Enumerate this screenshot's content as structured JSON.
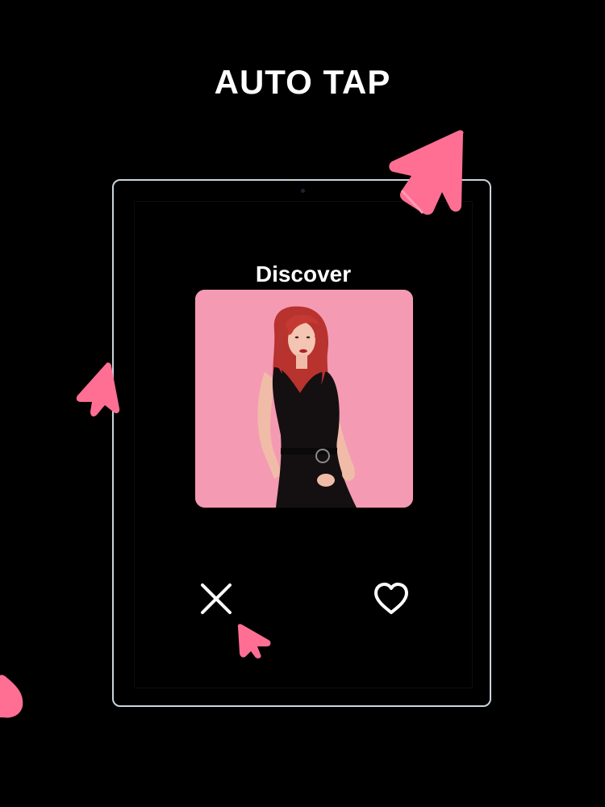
{
  "header": {
    "title": "AUTO TAP"
  },
  "screen": {
    "title": "Discover"
  },
  "actions": {
    "dislike_icon": "close-x-icon",
    "like_icon": "heart-outline-icon"
  },
  "colors": {
    "background": "#000000",
    "text": "#ffffff",
    "accent_pink": "#ff6f93",
    "card_pink": "#f49ab3",
    "device_border": "#c9d4dc"
  }
}
